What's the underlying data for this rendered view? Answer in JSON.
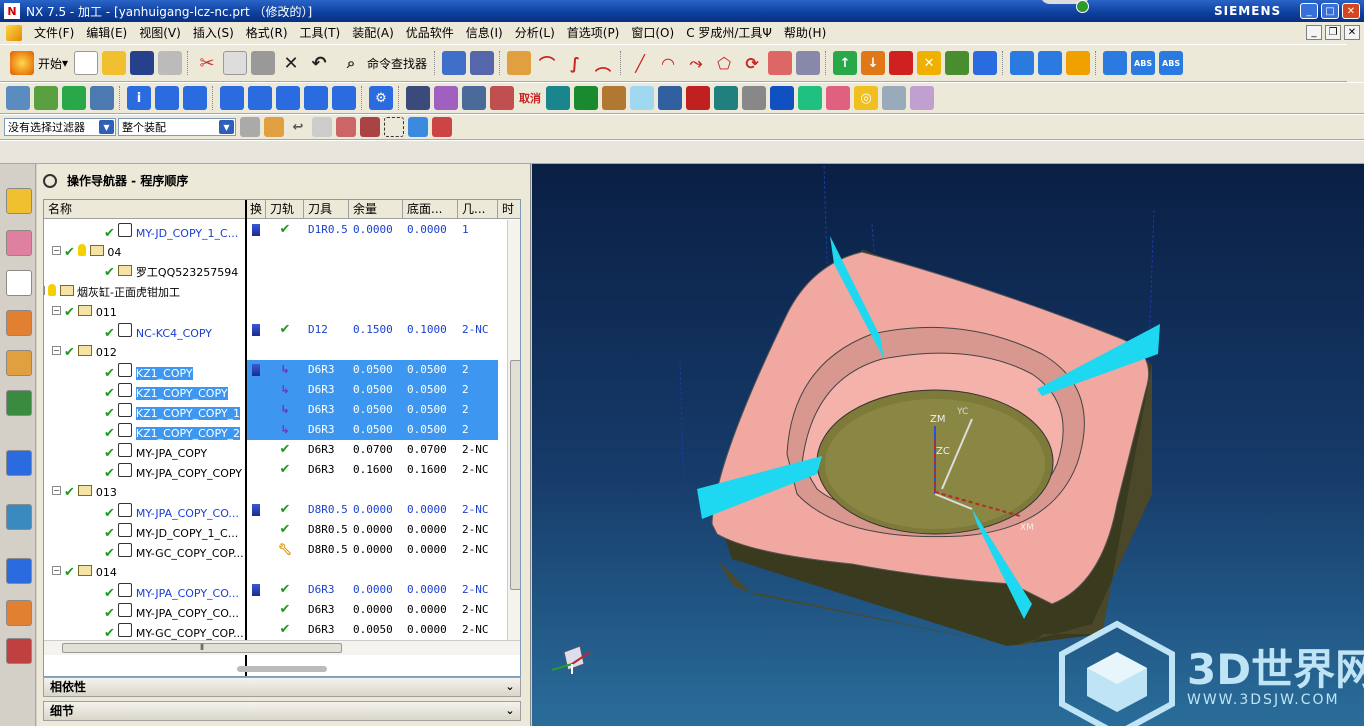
{
  "window": {
    "title": "NX 7.5 - 加工 - [yanhuigang-lcz-nc.prt （修改的）]",
    "brand": "SIEMENS",
    "min": "_",
    "max": "□",
    "close": "✕"
  },
  "menu": [
    "文件(F)",
    "编辑(E)",
    "视图(V)",
    "插入(S)",
    "格式(R)",
    "工具(T)",
    "装配(A)",
    "优品软件",
    "信息(I)",
    "分析(L)",
    "首选项(P)",
    "窗口(O)",
    "C 罗成州/工具Ψ",
    "帮助(H)"
  ],
  "toolbar": {
    "start": "开始",
    "cmd_finder": "命令查找器"
  },
  "filters": {
    "selection": "没有选择过滤器",
    "scope": "整个装配"
  },
  "navigator": {
    "title": "操作导航器 - 程序顺序",
    "columns": [
      "名称",
      "换",
      "刀轨",
      "刀具",
      "余量",
      "底面...",
      "几...",
      "时"
    ],
    "rows": [
      {
        "name": "MY-JD_COPY_1_C...",
        "tool": "D1R0.5",
        "stock": "0.0000",
        "floor": "0.0000",
        "geom": "1",
        "blue": true
      },
      {
        "name": "04"
      },
      {
        "name": "罗工QQ523257594"
      },
      {
        "name": "烟灰缸-正面虎钳加工"
      },
      {
        "name": "011"
      },
      {
        "name": "NC-KC4_COPY",
        "tool": "D12",
        "stock": "0.1500",
        "floor": "0.1000",
        "geom": "2-NC",
        "blue": true
      },
      {
        "name": "012"
      },
      {
        "name": "KZ1_COPY",
        "tool": "D6R3",
        "stock": "0.0500",
        "floor": "0.0500",
        "geom": "2"
      },
      {
        "name": "KZ1_COPY_COPY",
        "tool": "D6R3",
        "stock": "0.0500",
        "floor": "0.0500",
        "geom": "2"
      },
      {
        "name": "KZ1_COPY_COPY_1",
        "tool": "D6R3",
        "stock": "0.0500",
        "floor": "0.0500",
        "geom": "2"
      },
      {
        "name": "KZ1_COPY_COPY_2",
        "tool": "D6R3",
        "stock": "0.0500",
        "floor": "0.0500",
        "geom": "2"
      },
      {
        "name": "MY-JPA_COPY",
        "tool": "D6R3",
        "stock": "0.0700",
        "floor": "0.0700",
        "geom": "2-NC"
      },
      {
        "name": "MY-JPA_COPY_COPY",
        "tool": "D6R3",
        "stock": "0.1600",
        "floor": "0.1600",
        "geom": "2-NC"
      },
      {
        "name": "013"
      },
      {
        "name": "MY-JPA_COPY_CO...",
        "tool": "D8R0.5",
        "stock": "0.0000",
        "floor": "0.0000",
        "geom": "2-NC",
        "blue": true
      },
      {
        "name": "MY-JD_COPY_1_C...",
        "tool": "D8R0.5",
        "stock": "0.0000",
        "floor": "0.0000",
        "geom": "2-NC"
      },
      {
        "name": "MY-GC_COPY_COP...",
        "tool": "D8R0.5",
        "stock": "0.0000",
        "floor": "0.0000",
        "geom": "2-NC"
      },
      {
        "name": "014"
      },
      {
        "name": "MY-JPA_COPY_CO...",
        "tool": "D6R3",
        "stock": "0.0000",
        "floor": "0.0000",
        "geom": "2-NC",
        "blue": true
      },
      {
        "name": "MY-JPA_COPY_CO...",
        "tool": "D6R3",
        "stock": "0.0000",
        "floor": "0.0000",
        "geom": "2-NC"
      },
      {
        "name": "MY-GC_COPY_COP...",
        "tool": "D6R3",
        "stock": "0.0050",
        "floor": "0.0000",
        "geom": "2-NC"
      }
    ]
  },
  "panels": {
    "dependencies": "相依性",
    "details": "细节"
  },
  "viewport": {
    "axes": {
      "zm": "ZM",
      "zc": "ZC",
      "yc": "YC",
      "xm": "XM"
    }
  },
  "watermark": {
    "title": "3D世界网",
    "url": "WWW.3DSJW.COM"
  }
}
